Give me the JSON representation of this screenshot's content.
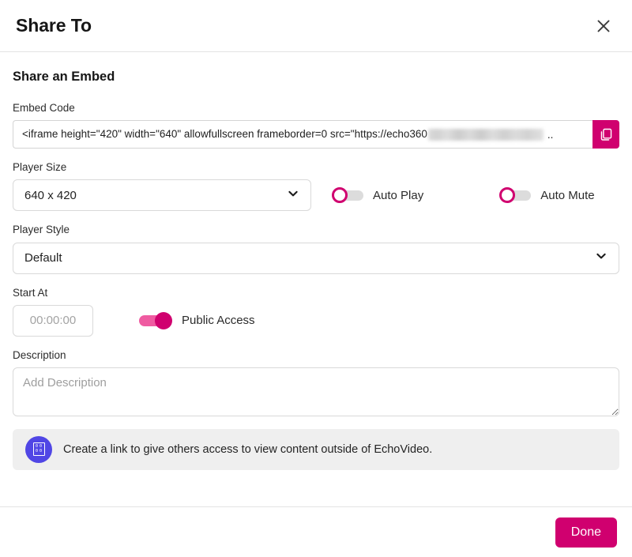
{
  "dialog": {
    "title": "Share To",
    "close_icon": "close-icon",
    "section_heading": "Share an Embed"
  },
  "embed": {
    "label": "Embed Code",
    "code_prefix": "<iframe height=\"420\" width=\"640\" allowfullscreen frameborder=0 src=\"https://echo360",
    "truncation": "..",
    "copy_icon": "copy-icon"
  },
  "player_size": {
    "label": "Player Size",
    "value": "640 x 420",
    "chevron_icon": "chevron-down-icon"
  },
  "auto_play": {
    "label": "Auto Play",
    "state": "off"
  },
  "auto_mute": {
    "label": "Auto Mute",
    "state": "off"
  },
  "player_style": {
    "label": "Player Style",
    "value": "Default",
    "chevron_icon": "chevron-down-icon"
  },
  "start_at": {
    "label": "Start At",
    "value": "",
    "placeholder": "00:00:00"
  },
  "public_access": {
    "label": "Public Access",
    "state": "on"
  },
  "description": {
    "label": "Description",
    "value": "",
    "placeholder": "Add Description"
  },
  "info_banner": {
    "icon": "missing-glyph-icon",
    "text": "Create a link to give others access to view content outside of EchoVideo."
  },
  "footer": {
    "done_label": "Done"
  },
  "colors": {
    "accent": "#d0006f",
    "accent_light": "#ef5ba1",
    "info_icon_bg": "#5046e5",
    "banner_bg": "#efefef"
  }
}
